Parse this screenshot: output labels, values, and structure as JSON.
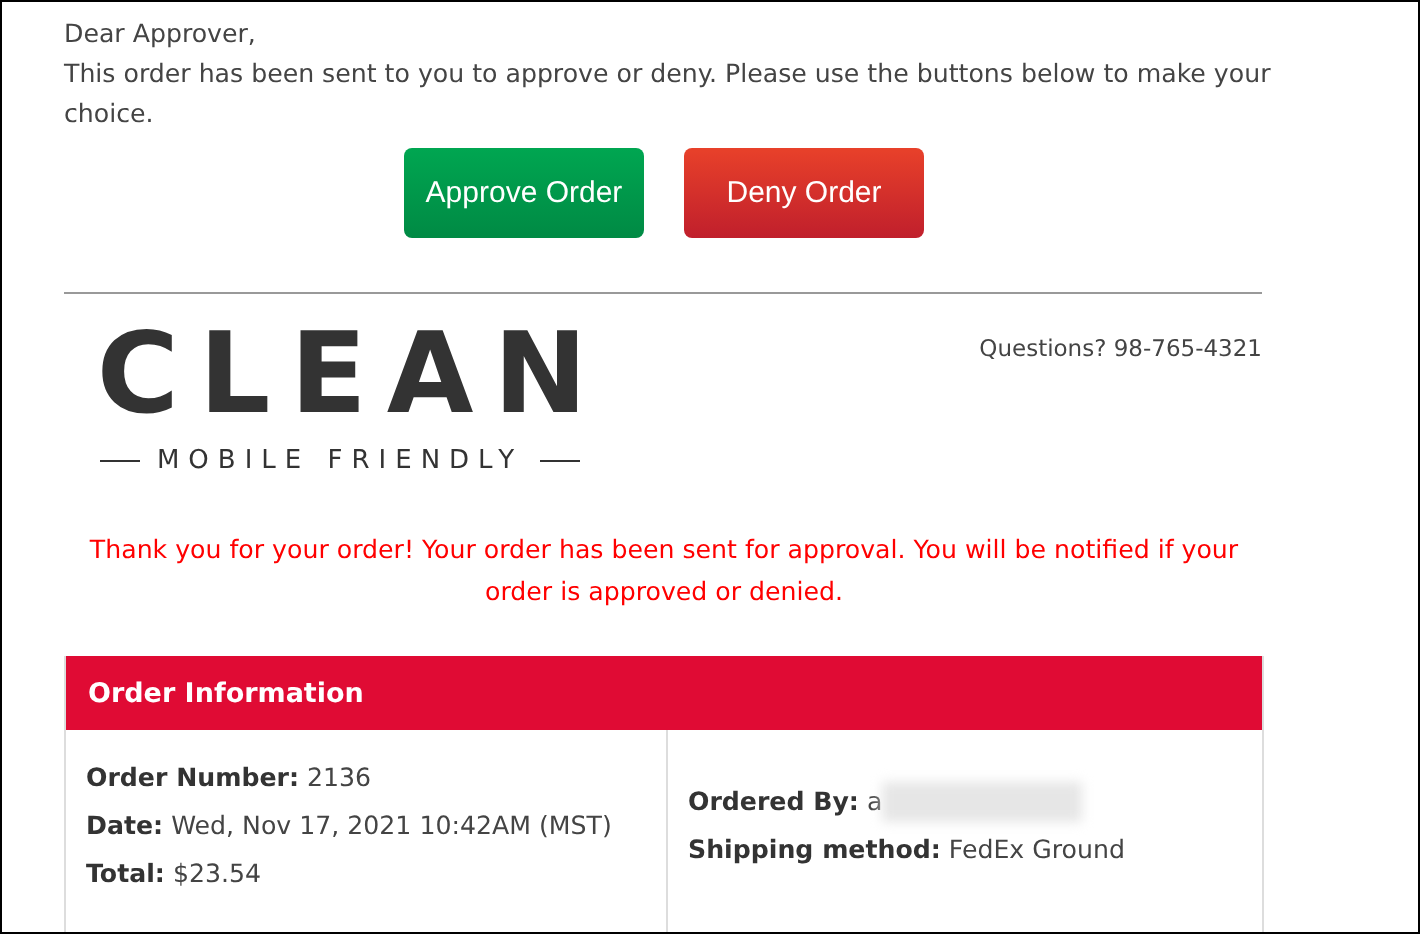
{
  "greeting": "Dear Approver,",
  "intro": "This order has been sent to you to approve or deny. Please use the buttons below to make your choice.",
  "buttons": [
    {
      "label": "Approve Order",
      "kind": "approve"
    },
    {
      "label": "Deny Order",
      "kind": "deny"
    }
  ],
  "logo": {
    "title": "CLEAN",
    "subtitle": "MOBILE FRIENDLY"
  },
  "contact": "Questions? 98-765-4321",
  "notice": "Thank you for your order! Your order has been sent for approval. You will be notified if your order is approved or denied.",
  "order_info": {
    "title": "Order Information",
    "left": [
      "**Order Number:** 2136",
      "**Date:** Wed, Nov 17, 2021 10:42AM (MST)",
      "**Total:** $23.54"
    ],
    "right": [
      {
        "text": "**Ordered By:** a",
        "redacted": true
      },
      {
        "text": "**Shipping method:** FedEx Ground",
        "redacted": false
      }
    ]
  }
}
